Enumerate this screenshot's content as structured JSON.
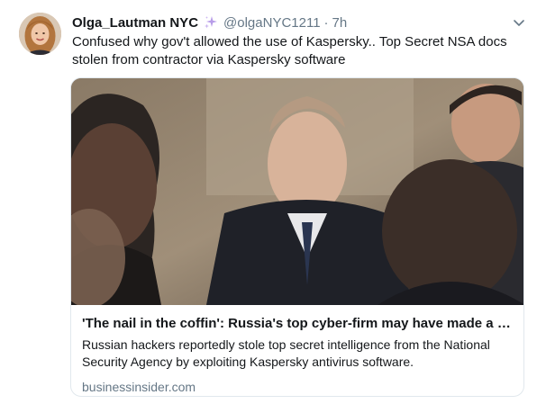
{
  "tweet": {
    "display_name": "Olga_Lautman NYC",
    "handle": "@olgaNYC1211",
    "separator": "·",
    "time": "7h",
    "text": "Confused why gov't allowed the use of Kaspersky.. Top Secret NSA docs stolen from contractor via Kaspersky software",
    "name_icon": "sparkles-icon",
    "menu_icon": "chevron-down-icon"
  },
  "card": {
    "title": "'The nail in the coffin': Russia's top cyber-firm may have made a 'cat...",
    "description": "Russian hackers reportedly stole top secret intelligence from the National Security Agency by exploiting Kaspersky antivirus software.",
    "domain": "businessinsider.com"
  },
  "colors": {
    "accent_sparkle": "#b79ce8",
    "secondary_text": "#657786",
    "border": "#e1e8ed"
  }
}
